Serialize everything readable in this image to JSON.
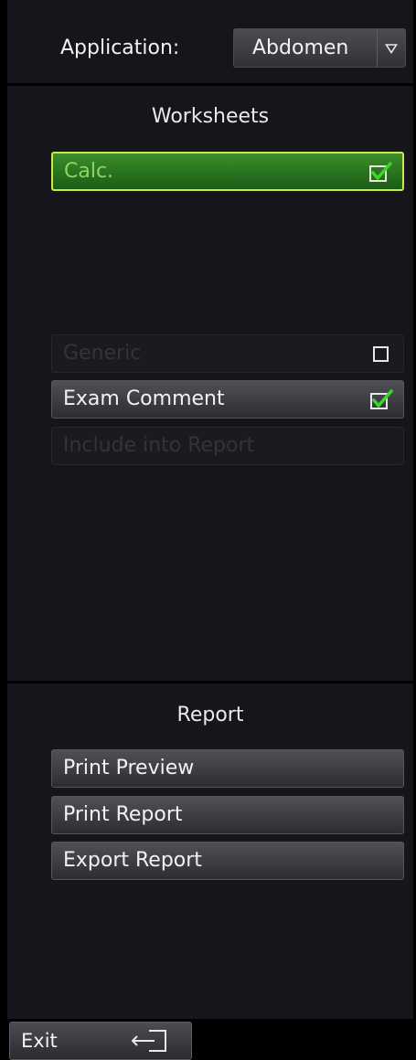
{
  "header": {
    "application_label": "Application:",
    "application_value": "Abdomen",
    "dropdown_icon": "triangle-down-icon"
  },
  "worksheets": {
    "title": "Worksheets",
    "items": [
      {
        "label": "Calc.",
        "state": "selected",
        "checked": true
      },
      {
        "label": "Generic",
        "state": "disabled",
        "checked": false
      },
      {
        "label": "Exam Comment",
        "state": "normal",
        "checked": true
      },
      {
        "label": "Include into Report",
        "state": "disabled"
      }
    ]
  },
  "report": {
    "title": "Report",
    "buttons": [
      "Print Preview",
      "Print Report",
      "Export Report"
    ]
  },
  "footer": {
    "exit_label": "Exit",
    "exit_icon": "exit-door-icon"
  },
  "colors": {
    "background": "#15161c",
    "selected_fill": "#2a7a22",
    "selected_border": "#d1e44a",
    "check_green": "#3bd62a"
  }
}
